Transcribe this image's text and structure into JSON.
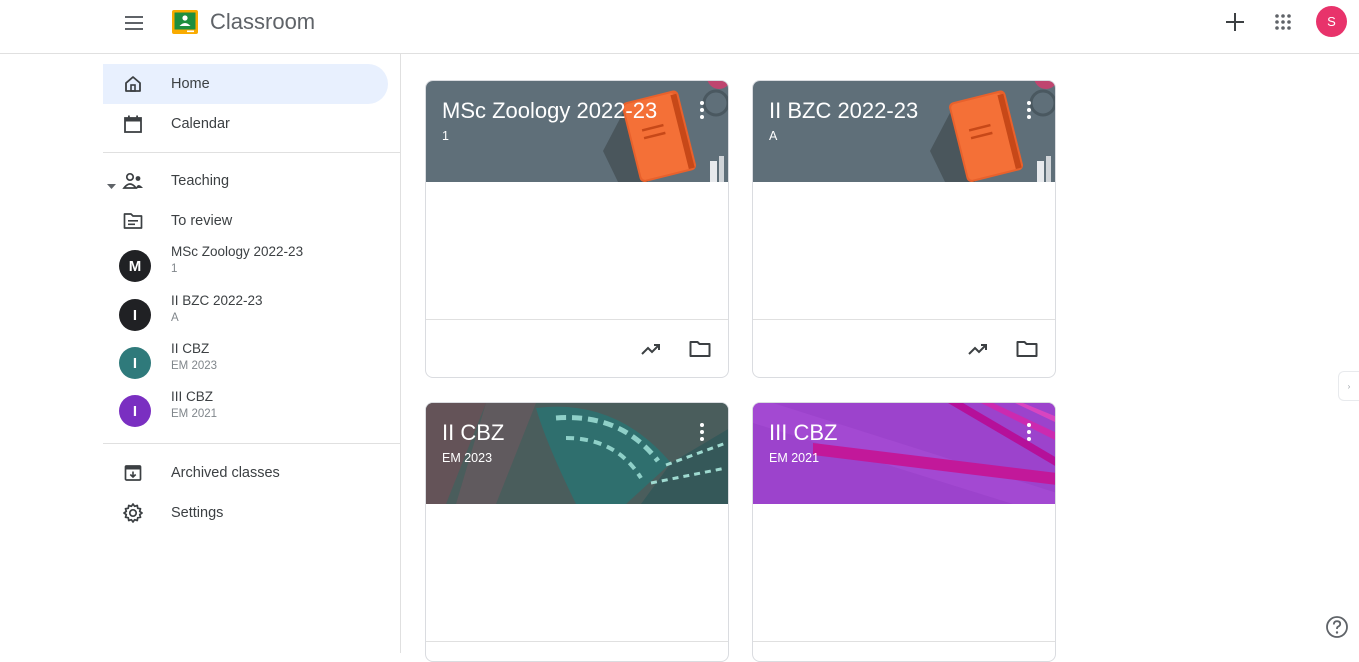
{
  "app": {
    "title": "Classroom"
  },
  "header": {
    "avatar_letter": "S"
  },
  "nav": {
    "home": "Home",
    "calendar": "Calendar",
    "teaching": "Teaching",
    "to_review": "To review",
    "archived": "Archived classes",
    "settings": "Settings"
  },
  "sidebar_classes": [
    {
      "letter": "M",
      "name": "MSc Zoology 2022-23",
      "section": "1",
      "color": "#202124"
    },
    {
      "letter": "I",
      "name": "II BZC 2022-23",
      "section": "A",
      "color": "#202124"
    },
    {
      "letter": "I",
      "name": "II CBZ",
      "section": "EM 2023",
      "color": "#2f7a7b"
    },
    {
      "letter": "I",
      "name": "III CBZ",
      "section": "EM 2021",
      "color": "#7a2fc1"
    }
  ],
  "cards": [
    {
      "title": "MSc Zoology 2022-23",
      "section": "1",
      "theme": "#5f6f79"
    },
    {
      "title": "II BZC 2022-23",
      "section": "A",
      "theme": "#5f6f79"
    },
    {
      "title": "II CBZ",
      "section": "EM 2023",
      "theme": "#3d5d5e"
    },
    {
      "title": "III CBZ",
      "section": "EM 2021",
      "theme": "#9b3ec8"
    }
  ],
  "icons": {
    "menu": "menu-icon",
    "create": "plus-icon",
    "apps": "apps-grid-icon",
    "home": "home-icon",
    "calendar": "calendar-icon",
    "teaching": "people-icon",
    "to_review": "review-icon",
    "archived": "archive-icon",
    "settings": "gear-icon",
    "gradebook": "trending-icon",
    "folder": "folder-icon",
    "help": "help-icon"
  }
}
